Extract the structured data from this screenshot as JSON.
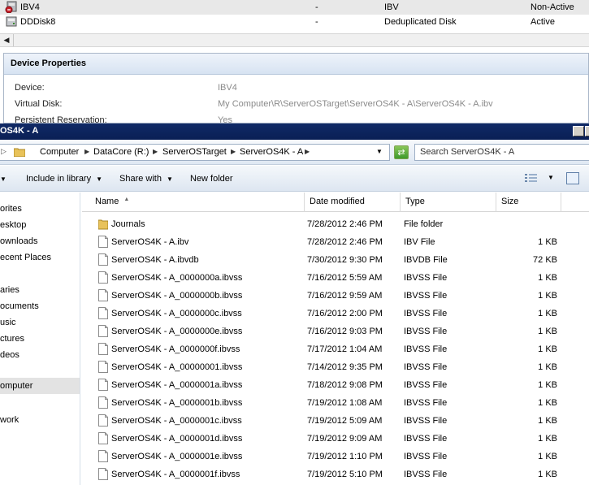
{
  "disks": [
    {
      "name": "IBV4",
      "col2": "-",
      "type": "IBV",
      "status": "Non-Active"
    },
    {
      "name": "DDDisk8",
      "col2": "-",
      "type": "Deduplicated Disk",
      "status": "Active"
    }
  ],
  "device_properties": {
    "header": "Device Properties",
    "rows": [
      {
        "key": "Device:",
        "value": "IBV4"
      },
      {
        "key": "Virtual Disk:",
        "value": "My Computer\\R\\ServerOSTarget\\ServerOS4K - A\\ServerOS4K - A.ibv"
      },
      {
        "key": "Persistent Reservation:",
        "value": "Yes"
      }
    ]
  },
  "window": {
    "title": "OS4K - A"
  },
  "address": {
    "crumbs": [
      "Computer",
      "DataCore (R:)",
      "ServerOSTarget",
      "ServerOS4K - A"
    ],
    "search_placeholder": "Search ServerOS4K - A"
  },
  "toolbar": {
    "include_label": "Include in library",
    "share_label": "Share with",
    "new_folder_label": "New folder"
  },
  "nav": [
    "orites",
    "esktop",
    "ownloads",
    "ecent Places",
    "aries",
    "ocuments",
    "usic",
    "ctures",
    "deos",
    "omputer",
    "work"
  ],
  "columns": {
    "name": "Name",
    "date": "Date modified",
    "type": "Type",
    "size": "Size"
  },
  "files": [
    {
      "name": "Journals",
      "date": "7/28/2012 2:46 PM",
      "type": "File folder",
      "size": "",
      "folder": true
    },
    {
      "name": "ServerOS4K - A.ibv",
      "date": "7/28/2012 2:46 PM",
      "type": "IBV File",
      "size": "1 KB"
    },
    {
      "name": "ServerOS4K - A.ibvdb",
      "date": "7/30/2012 9:30 PM",
      "type": "IBVDB File",
      "size": "72 KB"
    },
    {
      "name": "ServerOS4K - A_0000000a.ibvss",
      "date": "7/16/2012 5:59 AM",
      "type": "IBVSS File",
      "size": "1 KB"
    },
    {
      "name": "ServerOS4K - A_0000000b.ibvss",
      "date": "7/16/2012 9:59 AM",
      "type": "IBVSS File",
      "size": "1 KB"
    },
    {
      "name": "ServerOS4K - A_0000000c.ibvss",
      "date": "7/16/2012 2:00 PM",
      "type": "IBVSS File",
      "size": "1 KB"
    },
    {
      "name": "ServerOS4K - A_0000000e.ibvss",
      "date": "7/16/2012 9:03 PM",
      "type": "IBVSS File",
      "size": "1 KB"
    },
    {
      "name": "ServerOS4K - A_0000000f.ibvss",
      "date": "7/17/2012 1:04 AM",
      "type": "IBVSS File",
      "size": "1 KB"
    },
    {
      "name": "ServerOS4K - A_00000001.ibvss",
      "date": "7/14/2012 9:35 PM",
      "type": "IBVSS File",
      "size": "1 KB"
    },
    {
      "name": "ServerOS4K - A_0000001a.ibvss",
      "date": "7/18/2012 9:08 PM",
      "type": "IBVSS File",
      "size": "1 KB"
    },
    {
      "name": "ServerOS4K - A_0000001b.ibvss",
      "date": "7/19/2012 1:08 AM",
      "type": "IBVSS File",
      "size": "1 KB"
    },
    {
      "name": "ServerOS4K - A_0000001c.ibvss",
      "date": "7/19/2012 5:09 AM",
      "type": "IBVSS File",
      "size": "1 KB"
    },
    {
      "name": "ServerOS4K - A_0000001d.ibvss",
      "date": "7/19/2012 9:09 AM",
      "type": "IBVSS File",
      "size": "1 KB"
    },
    {
      "name": "ServerOS4K - A_0000001e.ibvss",
      "date": "7/19/2012 1:10 PM",
      "type": "IBVSS File",
      "size": "1 KB"
    },
    {
      "name": "ServerOS4K - A_0000001f.ibvss",
      "date": "7/19/2012 5:10 PM",
      "type": "IBVSS File",
      "size": "1 KB"
    }
  ]
}
